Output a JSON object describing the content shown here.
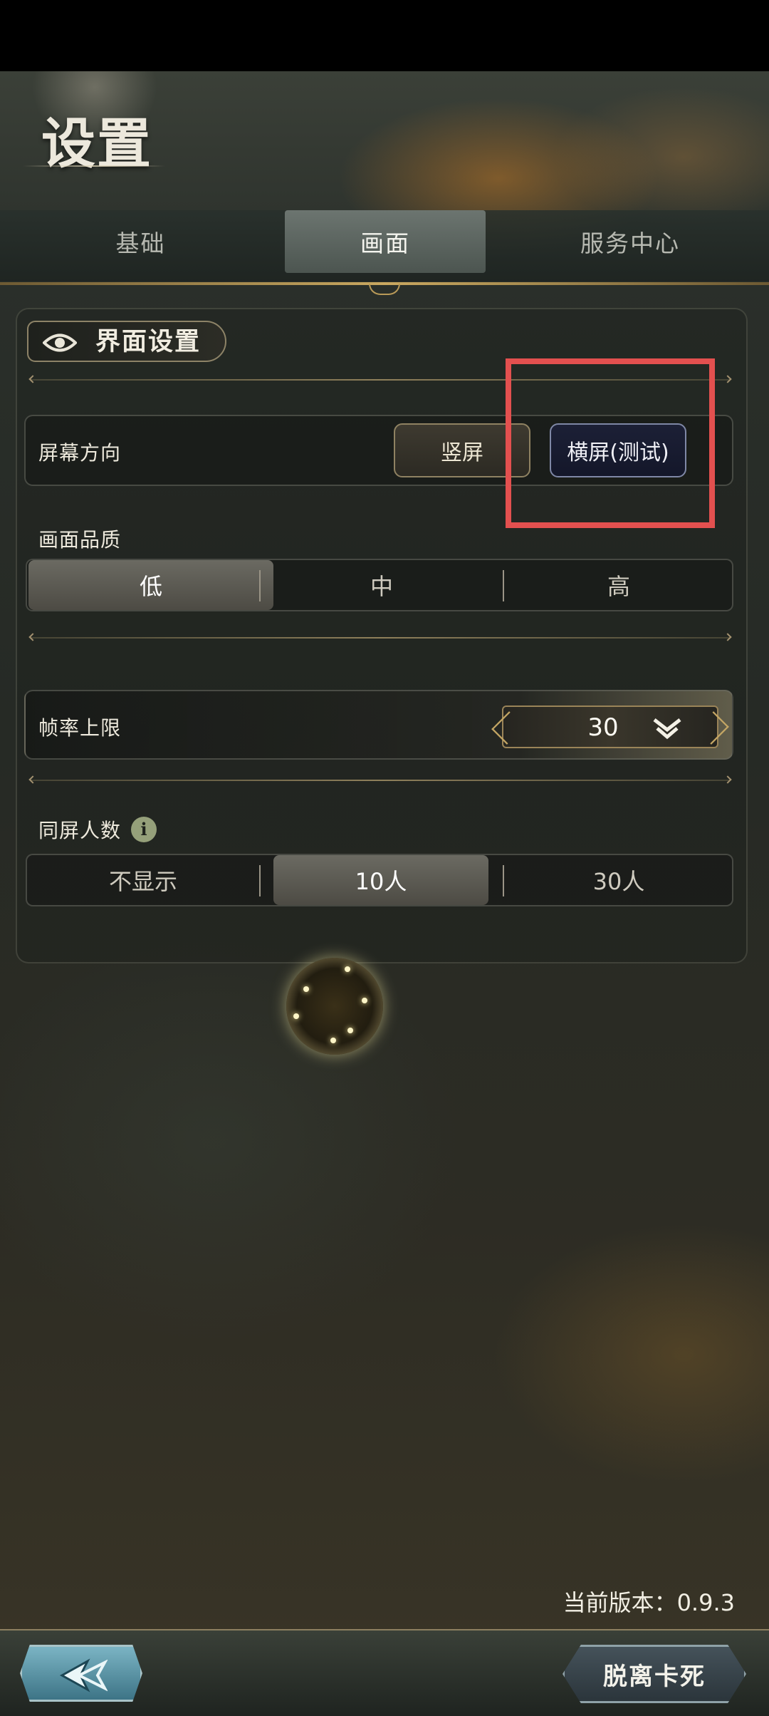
{
  "header": {
    "title": "设置"
  },
  "tabs": [
    {
      "label": "基础"
    },
    {
      "label": "画面",
      "selected": true
    },
    {
      "label": "服务中心"
    }
  ],
  "section": {
    "title": "界面设置",
    "icon": "eye-icon"
  },
  "orientation": {
    "label": "屏幕方向",
    "options": [
      "竖屏",
      "横屏(测试)"
    ],
    "selected": "横屏(测试)"
  },
  "quality": {
    "label": "画面品质",
    "options": [
      "低",
      "中",
      "高"
    ],
    "selected": "低"
  },
  "fps": {
    "label": "帧率上限",
    "value": "30",
    "icon": "chevron-down-icon"
  },
  "players": {
    "label": "同屏人数",
    "info_icon": "i",
    "options": [
      "不显示",
      "10人",
      "30人"
    ],
    "selected": "10人"
  },
  "footer": {
    "version": "当前版本：0.9.3",
    "back_icon": "back-arrow-icon",
    "exit_label": "脱离卡死"
  },
  "colors": {
    "accent_gold": "#c9a860",
    "highlight": "#e3504f",
    "selected_landscape": "#14172a"
  }
}
